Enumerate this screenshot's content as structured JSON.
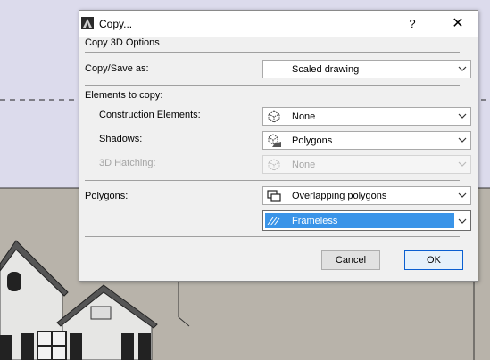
{
  "window": {
    "title": "Copy...",
    "help_glyph": "?",
    "close_glyph": "✕"
  },
  "section_header": "Copy 3D Options",
  "copy_save": {
    "label": "Copy/Save as:",
    "value": "Scaled drawing"
  },
  "elements": {
    "header": "Elements to copy:",
    "construction": {
      "label": "Construction Elements:",
      "value": "None"
    },
    "shadows": {
      "label": "Shadows:",
      "value": "Polygons"
    },
    "hatching": {
      "label": "3D Hatching:",
      "value": "None",
      "disabled": true
    }
  },
  "polygons": {
    "label": "Polygons:",
    "value": "Overlapping polygons",
    "style_value": "Frameless"
  },
  "buttons": {
    "cancel": "Cancel",
    "ok": "OK"
  },
  "colors": {
    "selection": "#3a94e8",
    "ok_border": "#0a5fd1",
    "background_canvas": "#dcdbec",
    "house_wall": "#b8b3aa"
  },
  "icons": {
    "app": "archicad-app-icon",
    "construction": "cube-outline-icon",
    "shadows": "cube-shadow-icon",
    "hatching": "cube-outline-icon",
    "polygons": "overlapping-polygons-icon",
    "style": "hatch-pattern-icon",
    "dropdown": "chevron-down-icon"
  }
}
